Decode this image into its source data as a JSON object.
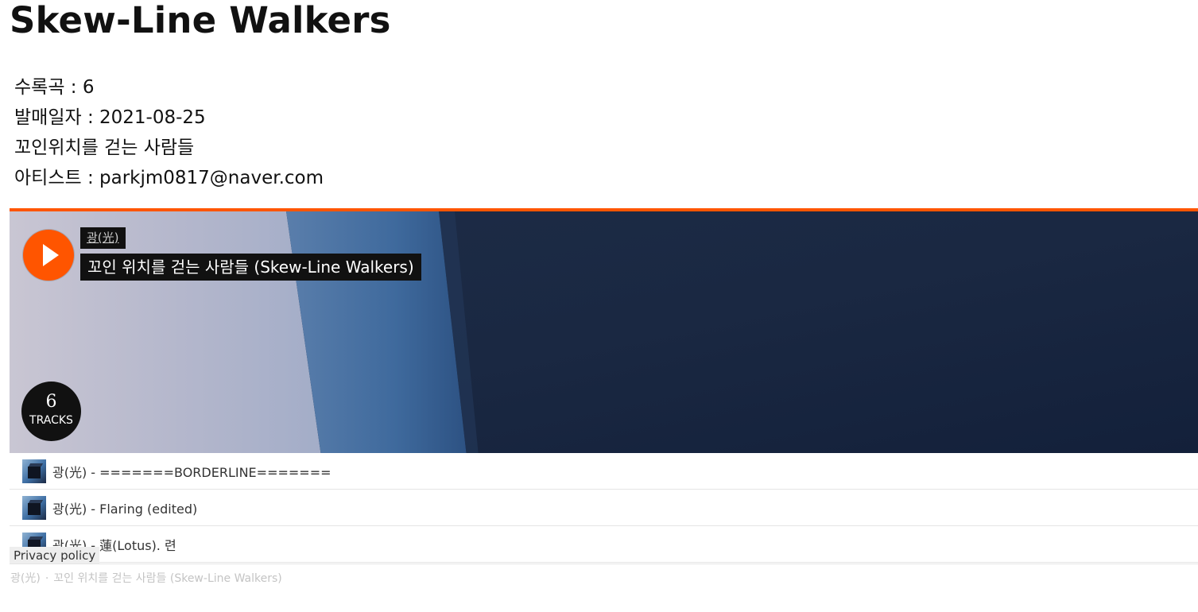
{
  "album": {
    "title": "Skew-Line Walkers",
    "meta_lines": [
      "수록곡 : 6",
      "발매일자 : 2021-08-25",
      "꼬인위치를 걷는 사람들",
      "아티스트 : parkjm0817@naver.com"
    ]
  },
  "player": {
    "accent_color": "#ff5500",
    "artist": "광(光)",
    "playlist_title": "꼬인 위치를 걷는 사람들 (Skew-Line Walkers)",
    "play_icon": "play-icon",
    "tracks_count": "6",
    "tracks_word": "TRACKS"
  },
  "tracks": [
    "광(光) - =======BORDERLINE=======",
    "광(光) - Flaring (edited)",
    "광(光) - 蓮(Lotus). 련"
  ],
  "privacy_label": "Privacy policy",
  "footer": {
    "artist": "광(光)",
    "separator": "·",
    "title": "꼬인 위치를 걷는 사람들 (Skew-Line Walkers)"
  }
}
